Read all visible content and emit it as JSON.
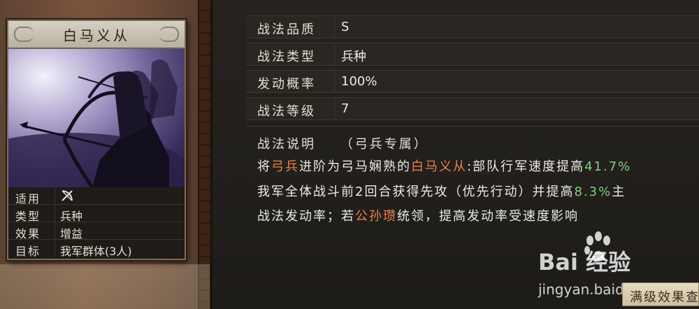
{
  "skill_card": {
    "name": "白马义从",
    "attributes": [
      {
        "label": "适用",
        "value": ""
      },
      {
        "label": "类型",
        "value": "兵种"
      },
      {
        "label": "效果",
        "value": "增益"
      },
      {
        "label": "目标",
        "value": "我军群体(3人)"
      }
    ]
  },
  "info": [
    {
      "label": "战法品质",
      "value": "S"
    },
    {
      "label": "战法类型",
      "value": "兵种"
    },
    {
      "label": "发动概率",
      "value": "100%"
    },
    {
      "label": "战法等级",
      "value": "7"
    }
  ],
  "description": {
    "label": "战法说明",
    "tag": "（弓兵专属）",
    "line1": {
      "p1": "将",
      "troop": "弓兵",
      "p2": "进阶为弓马娴熟的",
      "skill": "白马义从",
      "p3": ":部队行军速度提高",
      "speed": "41.7%"
    },
    "line2": {
      "p1": "我军全体战斗前2回合获得先攻（优先行动）并提高",
      "rate": "8.3%",
      "p2": "主"
    },
    "line3": {
      "p1": "战法发动率；若",
      "general": "公孙瓒",
      "p2": "统领，提高发动率受速度影响"
    }
  },
  "watermark": {
    "logo": "Bai 经验",
    "url": "jingyan.baidu.com"
  },
  "full_effect_button": "满级效果查看",
  "colors": {
    "highlight_orange": "#e8834a",
    "highlight_green": "#7fd07a",
    "art_purple": "#6e5f9a"
  },
  "icons": {
    "applicable_icon": "bow-crossed-icon"
  }
}
